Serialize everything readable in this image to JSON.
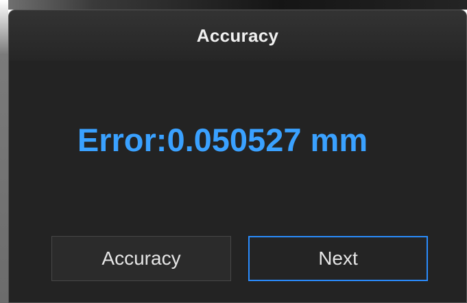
{
  "window": {
    "title": "Accuracy"
  },
  "result": {
    "text": "Error:0.050527 mm"
  },
  "actions": {
    "accuracy_label": "Accuracy",
    "next_label": "Next"
  },
  "icons": [],
  "colors": {
    "accent": "#2a8dff",
    "error_text": "#3aa1ff",
    "dialog_background": "#232323",
    "title_background": "#2d2d2d"
  }
}
